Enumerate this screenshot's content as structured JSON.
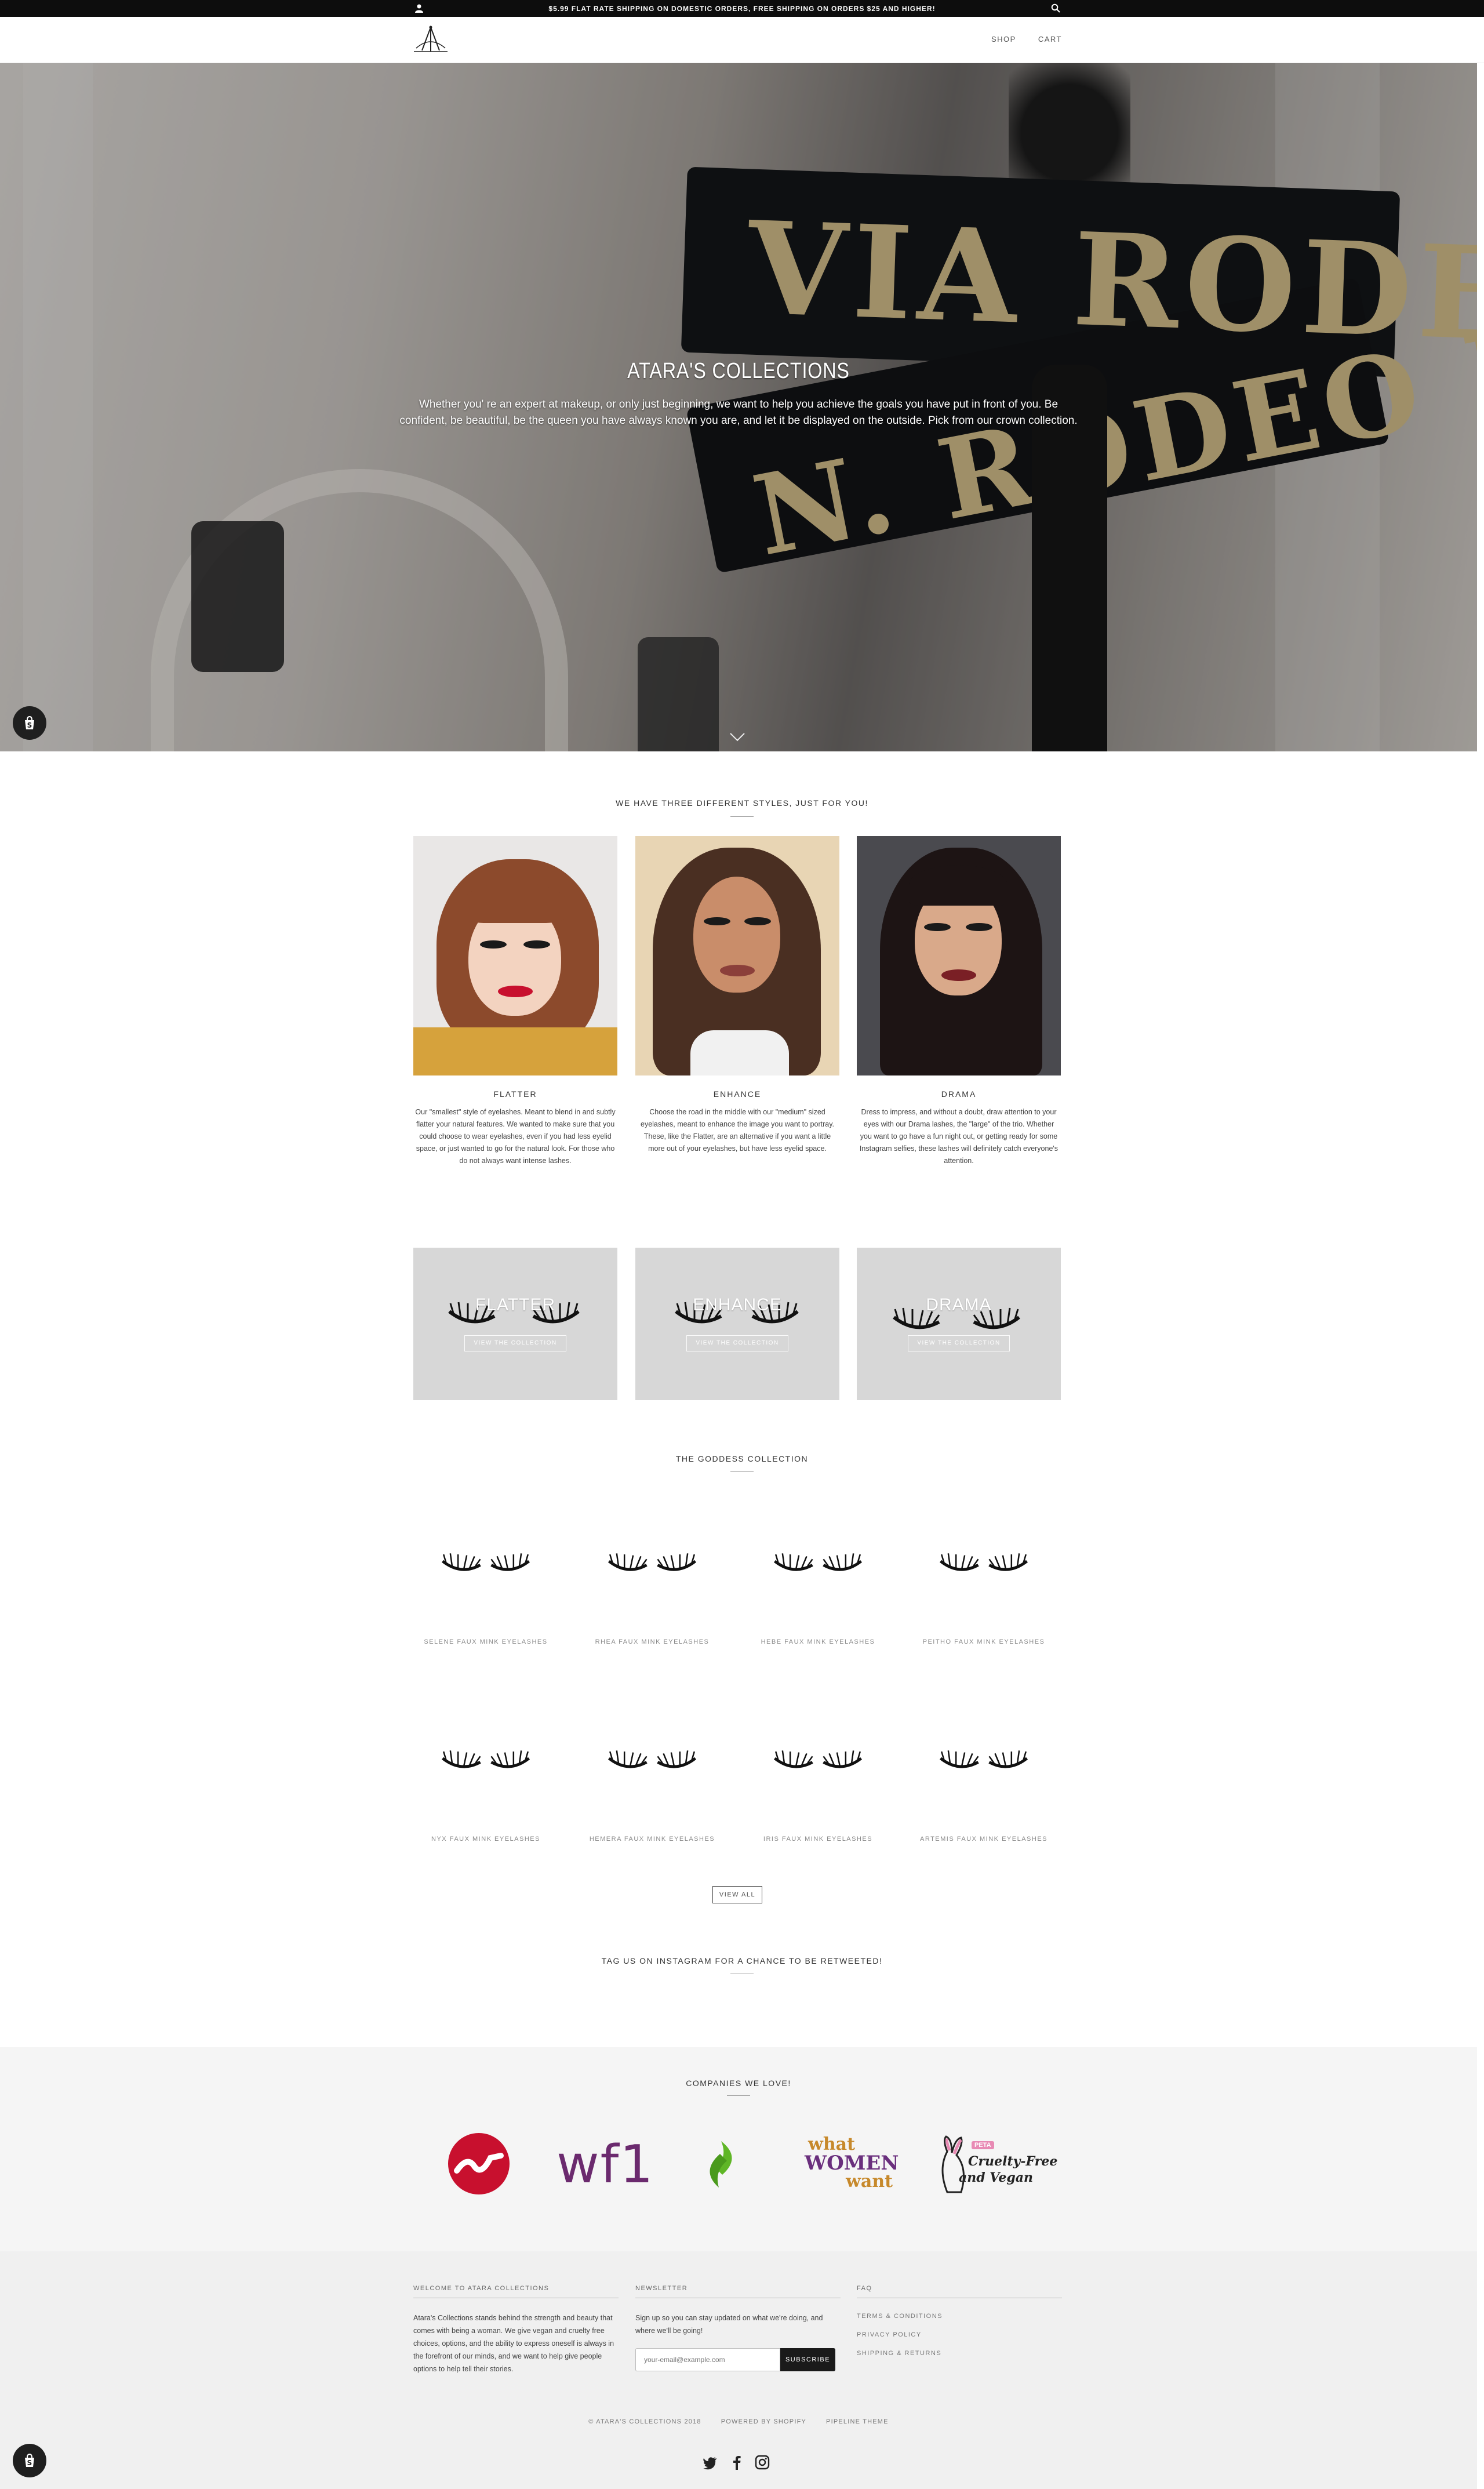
{
  "announcement": {
    "text": "$5.99 FLAT RATE SHIPPING ON DOMESTIC ORDERS, FREE SHIPPING ON ORDERS $25 AND HIGHER!",
    "user_icon": "user-icon",
    "search_icon": "search-icon"
  },
  "header": {
    "logo_icon": "crown-logo",
    "nav": [
      {
        "label": "SHOP"
      },
      {
        "label": "CART"
      }
    ]
  },
  "hero": {
    "title": "ATARA'S COLLECTIONS",
    "text": "Whether you' re an expert at makeup, or only just beginning, we want to help you achieve the goals you have put in front of you. Be confident, be beautiful, be the queen you have always known you are, and let it be displayed on the outside. Pick from our crown collection.",
    "sign_line1": "VIA RODEO",
    "sign_line2": "N. RODEO DR",
    "scroll_icon": "chevron-down-icon"
  },
  "styles": {
    "heading": "WE HAVE THREE DIFFERENT STYLES, JUST FOR YOU!",
    "items": [
      {
        "name": "FLATTER",
        "text": "Our \"smallest\" style of eyelashes. Meant to blend in and subtly flatter your natural features. We wanted to make sure that you could choose to wear eyelashes, even if you had less eyelid space, or just wanted to go for the natural look. For those who do not always want intense lashes."
      },
      {
        "name": "ENHANCE",
        "text": "Choose the road in the middle with our \"medium\" sized eyelashes, meant to enhance the image you want to portray. These, like the Flatter, are an alternative if you want a little more out of your eyelashes, but have less eyelid space."
      },
      {
        "name": "DRAMA",
        "text": "Dress to impress, and without a doubt, draw attention to your eyes with our Drama lashes, the \"large\" of the trio. Whether you want to go have a fun night out, or getting ready for some Instagram selfies, these lashes will definitely catch everyone's attention."
      }
    ]
  },
  "collections": [
    {
      "name": "FLATTER",
      "button": "VIEW THE COLLECTION"
    },
    {
      "name": "ENHANCE",
      "button": "VIEW THE COLLECTION"
    },
    {
      "name": "DRAMA",
      "button": "VIEW THE COLLECTION"
    }
  ],
  "goddess": {
    "heading": "THE GODDESS COLLECTION",
    "products": [
      {
        "name": "SELENE FAUX MINK EYELASHES"
      },
      {
        "name": "RHEA FAUX MINK EYELASHES"
      },
      {
        "name": "HEBE FAUX MINK EYELASHES"
      },
      {
        "name": "PEITHO FAUX MINK EYELASHES"
      },
      {
        "name": "NYX FAUX MINK EYELASHES"
      },
      {
        "name": "HEMERA FAUX MINK EYELASHES"
      },
      {
        "name": "IRIS FAUX MINK EYELASHES"
      },
      {
        "name": "ARTEMIS FAUX MINK EYELASHES"
      }
    ],
    "view_all": "VIEW ALL"
  },
  "instagram": {
    "heading": "TAG US ON INSTAGRAM FOR A CHANCE TO BE RETWEETED!"
  },
  "companies": {
    "heading": "COMPANIES WE LOVE!",
    "logo2_text": "wf1",
    "logo4_line1": "what",
    "logo4_line2": "WOMEN",
    "logo4_line3": "want",
    "logo5_badge": "PETA",
    "logo5_line1": "Cruelty-Free",
    "logo5_line2": "and Vegan"
  },
  "footer": {
    "welcome_title": "WELCOME TO ATARA COLLECTIONS",
    "welcome_text": "Atara's Collections stands behind the strength and beauty that comes with being a woman. We give vegan and cruelty free choices, options, and the ability to express oneself is always in the forefront of our minds, and we want to help give people options to help tell their stories.",
    "newsletter_title": "NEWSLETTER",
    "newsletter_text": "Sign up so you can stay updated on what we're doing, and where we'll be going!",
    "email_placeholder": "your-email@example.com",
    "subscribe_label": "SUBSCRIBE",
    "faq_title": "FAQ",
    "faq_links": [
      {
        "label": "TERMS & CONDITIONS"
      },
      {
        "label": "PRIVACY POLICY"
      },
      {
        "label": "SHIPPING & RETURNS"
      }
    ],
    "copyright": "© ATARA'S COLLECTIONS 2018",
    "powered": "POWERED BY SHOPIFY",
    "theme": "PIPELINE THEME",
    "social_icons": [
      "twitter-icon",
      "facebook-icon",
      "instagram-icon"
    ]
  },
  "colors": {
    "topbar": "#0d0d0d",
    "companies_bg": "#f5f5f5",
    "footer_bg": "#f0f0f0",
    "tile_bg": "#d7d7d7",
    "brand_red": "#c8102e",
    "wf1_purple": "#6b2a6e",
    "green_logo": "#5fb626",
    "www_gold": "#c7892b",
    "www_purple": "#6a2f7d"
  }
}
